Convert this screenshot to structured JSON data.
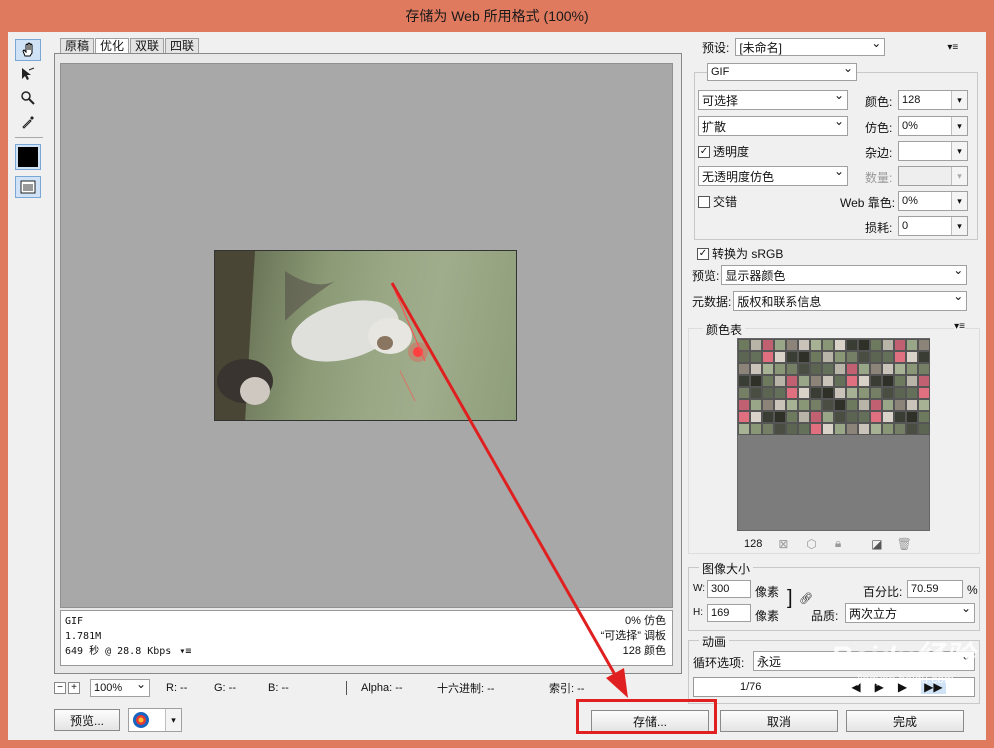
{
  "title": "存储为 Web 所用格式 (100%)",
  "tabs": [
    "原稿",
    "优化",
    "双联",
    "四联"
  ],
  "info": {
    "format": "GIF",
    "size": "1.781M",
    "time": "649 秒 @ 28.8 Kbps",
    "dither": "0% 仿色",
    "palette": "“可选择” 调板",
    "colors": "128 颜色"
  },
  "zoom": {
    "value": "100%",
    "r": "R: --",
    "g": "G: --",
    "b": "B: --",
    "alpha": "Alpha: --",
    "hex": "十六进制: --",
    "index": "索引: --"
  },
  "bottom": {
    "preview": "预览...",
    "save": "存储...",
    "cancel": "取消",
    "done": "完成"
  },
  "settings": {
    "preset_label": "预设:",
    "preset_value": "[未命名]",
    "format": "GIF",
    "reduction": "可选择",
    "colors_label": "颜色:",
    "colors_value": "128",
    "dither_algo": "扩散",
    "dither_label": "仿色:",
    "dither_value": "0%",
    "transparency_label": "透明度",
    "matte_label": "杂边:",
    "trans_dither": "无透明度仿色",
    "amount_label": "数量:",
    "interlaced_label": "交错",
    "websnap_label": "Web 靠色:",
    "websnap_value": "0%",
    "lossy_label": "损耗:",
    "lossy_value": "0",
    "srgb_label": "转换为 sRGB",
    "preview_label": "预览:",
    "preview_value": "显示器颜色",
    "metadata_label": "元数据:",
    "metadata_value": "版权和联系信息"
  },
  "color_table": {
    "title": "颜色表",
    "count": "128"
  },
  "image_size": {
    "title": "图像大小",
    "w_label": "W:",
    "w_value": "300",
    "h_label": "H:",
    "h_value": "169",
    "unit": "像素",
    "percent_label": "百分比:",
    "percent_value": "70.59",
    "percent_unit": "%",
    "quality_label": "品质:",
    "quality_value": "两次立方"
  },
  "animation": {
    "title": "动画",
    "loop_label": "循环选项:",
    "loop_value": "永远",
    "frame": "1/76"
  },
  "watermark": {
    "brand": "Baidu经验",
    "url": "jingyan.baidu.com"
  },
  "colors": {
    "accent_red": "#e02020",
    "title_bg": "#e07a5f"
  }
}
